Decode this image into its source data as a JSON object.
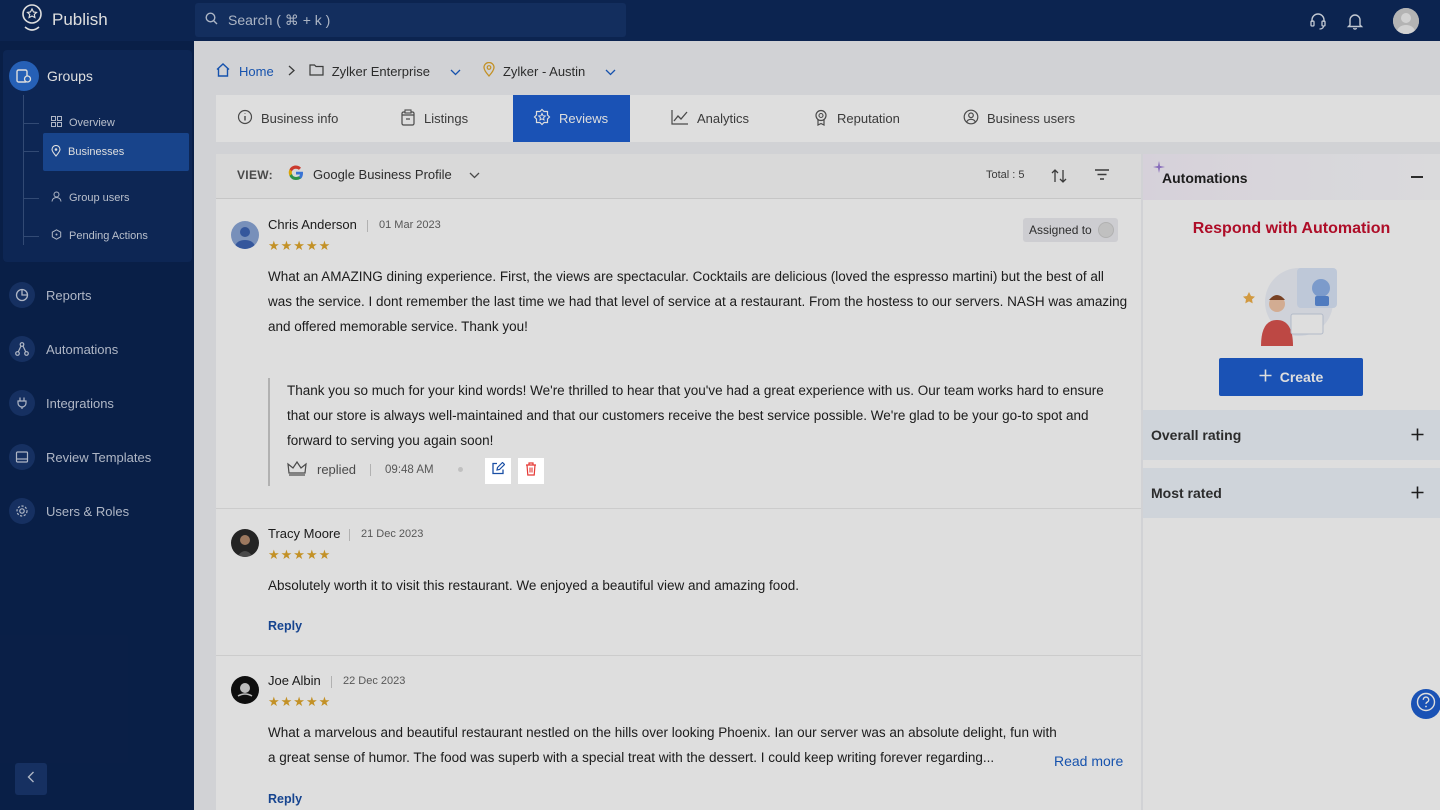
{
  "app": {
    "name": "Publish"
  },
  "search": {
    "placeholder": "Search ( ⌘ + k )"
  },
  "sidebar": {
    "group_label": "Groups",
    "sub_items": [
      {
        "label": "Overview",
        "icon": "grid-icon"
      },
      {
        "label": "Businesses",
        "icon": "location-pin-icon",
        "active": true
      },
      {
        "label": "Group users",
        "icon": "user-icon"
      },
      {
        "label": "Pending Actions",
        "icon": "pending-icon"
      }
    ],
    "items": [
      {
        "label": "Reports",
        "icon": "pie-chart-icon"
      },
      {
        "label": "Automations",
        "icon": "flow-icon"
      },
      {
        "label": "Integrations",
        "icon": "plug-icon"
      },
      {
        "label": "Review Templates",
        "icon": "template-icon"
      },
      {
        "label": "Users & Roles",
        "icon": "gear-icon"
      }
    ]
  },
  "breadcrumb": {
    "home": "Home",
    "enterprise": "Zylker Enterprise",
    "location": "Zylker - Austin"
  },
  "tabs": [
    {
      "label": "Business info"
    },
    {
      "label": "Listings"
    },
    {
      "label": "Reviews",
      "active": true
    },
    {
      "label": "Analytics"
    },
    {
      "label": "Reputation"
    },
    {
      "label": "Business users"
    }
  ],
  "reviews_panel": {
    "view_label": "VIEW:",
    "source": "Google Business Profile",
    "total": "Total : 5",
    "reviews": [
      {
        "name": "Chris Anderson",
        "date": "01 Mar 2023",
        "rating": 5,
        "stars": "★★★★★",
        "text": "What an AMAZING dining experience. First, the views are spectacular. Cocktails are delicious (loved the espresso martini) but the best of all was the service. I dont remember the last time we had that level of service at a restaurant. From the hostess to our servers. NASH was amazing and offered memorable service. Thank you!",
        "assigned_label": "Assigned to",
        "reply": {
          "text": "Thank you so much for your kind words! We're thrilled to hear that you've had a great experience with us. Our team works hard to ensure that our store is always well-maintained and that our customers receive the best service possible. We're glad to be your go-to spot and forward to serving you again soon!",
          "status": "replied",
          "time": "09:48 AM"
        }
      },
      {
        "name": "Tracy Moore",
        "date": "21 Dec 2023",
        "rating": 5,
        "stars": "★★★★★",
        "text": "Absolutely worth it to visit this restaurant. We enjoyed a beautiful view and amazing food.",
        "reply_label": "Reply"
      },
      {
        "name": "Joe Albin",
        "date": "22 Dec 2023",
        "rating": 5,
        "stars": "★★★★★",
        "text": "What a marvelous and beautiful restaurant nestled on the hills over looking Phoenix. Ian our server was an absolute delight, fun with a great sense of humor. The food was superb with a special treat with the dessert. I could keep writing forever regarding...",
        "read_more": "Read more",
        "reply_label": "Reply"
      }
    ]
  },
  "right_panel": {
    "automations_title": "Automations",
    "respond_title": "Respond with Automation",
    "create_label": "Create",
    "overall_rating": "Overall rating",
    "most_rated": "Most rated"
  },
  "colors": {
    "topbar": "#0e2a5c",
    "sidebar": "#0b2452",
    "accent": "#1e5fd0",
    "star": "#e0a72c",
    "respond_red": "#c8102e"
  }
}
